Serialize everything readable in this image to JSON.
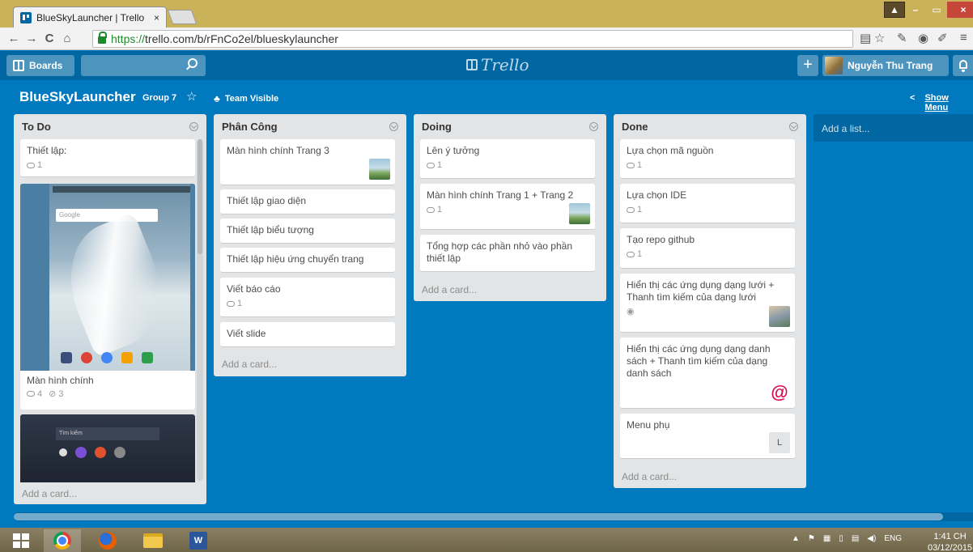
{
  "browser": {
    "tab_title": "BlueSkyLauncher | Trello",
    "tab_close": "×",
    "url_scheme": "https://",
    "url_rest": "trello.com/b/rFnCo2el/blueskylauncher",
    "nav": {
      "back": "←",
      "forward": "→",
      "reload": "C",
      "home": "⌂"
    },
    "window_controls": {
      "user": "▲",
      "minimize": "–",
      "maximize": "▭",
      "close": "×"
    }
  },
  "header": {
    "boards_label": "Boards",
    "logo_text": "Trello",
    "plus": "+",
    "user_name": "Nguyễn Thu Trang"
  },
  "board": {
    "title": "BlueSkyLauncher",
    "org": "Group 7",
    "star": "☆",
    "visibility": "Team Visible",
    "show_menu_chevron": "<",
    "show_menu": "Show Menu",
    "add_list": "Add a list..."
  },
  "lists": [
    {
      "name": "To Do",
      "cards": [
        {
          "title": "Thiết lập:",
          "comments": "1"
        },
        {
          "title": "Màn hình chính",
          "comments": "4",
          "attachments": "3",
          "google_text": "Google"
        },
        {
          "search_text": "Tìm kiếm"
        }
      ],
      "add_card": "Add a card..."
    },
    {
      "name": "Phân Công",
      "cards": [
        {
          "title": "Màn hình chính Trang 3"
        },
        {
          "title": "Thiết lập giao diện"
        },
        {
          "title": "Thiết lập biểu tượng"
        },
        {
          "title": "Thiết lập hiệu ứng chuyển trang"
        },
        {
          "title": "Viết báo cáo",
          "comments": "1"
        },
        {
          "title": "Viết slide"
        }
      ],
      "add_card": "Add a card..."
    },
    {
      "name": "Doing",
      "cards": [
        {
          "title": "Lên ý tưởng",
          "comments": "1"
        },
        {
          "title": "Màn hình chính Trang 1 + Trang 2",
          "comments": "1"
        },
        {
          "title": "Tổng hợp các phần nhỏ vào phần thiết lập"
        }
      ],
      "add_card": "Add a card..."
    },
    {
      "name": "Done",
      "cards": [
        {
          "title": "Lựa chọn mã nguồn",
          "comments": "1"
        },
        {
          "title": "Lựa chọn IDE",
          "comments": "1"
        },
        {
          "title": "Tạo repo github",
          "comments": "1"
        },
        {
          "title": "Hiển thị các ứng dụng dạng lưới + Thanh tìm kiếm của dạng lưới",
          "watch": "◉"
        },
        {
          "title": "Hiển thị các ứng dụng dạng danh sách + Thanh tìm kiếm của dạng danh sách",
          "member_icon": "@"
        },
        {
          "title": "Menu phụ",
          "member": "L"
        }
      ],
      "add_card": "Add a card..."
    }
  ],
  "taskbar": {
    "word_label": "W",
    "lang": "ENG",
    "time": "1:41 CH",
    "date": "03/12/2015"
  },
  "colors": {
    "board_bg": "#0079bf",
    "header_bg": "#0067a3",
    "list_bg": "#e2e4e6"
  }
}
